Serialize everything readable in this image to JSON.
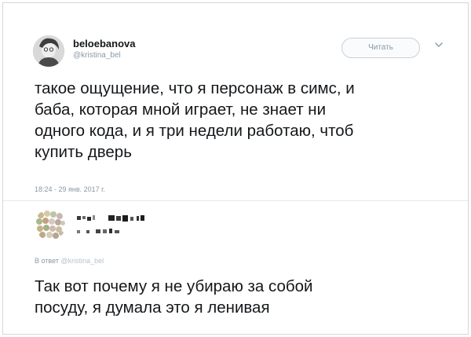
{
  "tweet": {
    "display_name": "beloebanova",
    "handle": "@kristina_bel",
    "follow_label": "Читать",
    "text": "такое ощущение, что я персонаж в симс, и\nбаба, которая мной играет, не знает ни\nодного кода, и я три недели работаю, чтоб\nкупить дверь",
    "timestamp": "18:24 - 29 янв. 2017 г."
  },
  "reply": {
    "reply_to_prefix": "В ответ",
    "reply_to_handle": "@kristina_bel",
    "text": "Так вот почему я не убираю за собой\nпосуду, я думала это я ленивая"
  },
  "icons": {
    "menu": "chevron-down-icon"
  },
  "colors": {
    "text": "#14171a",
    "muted": "#8899a6",
    "border": "#e1e8ed"
  }
}
